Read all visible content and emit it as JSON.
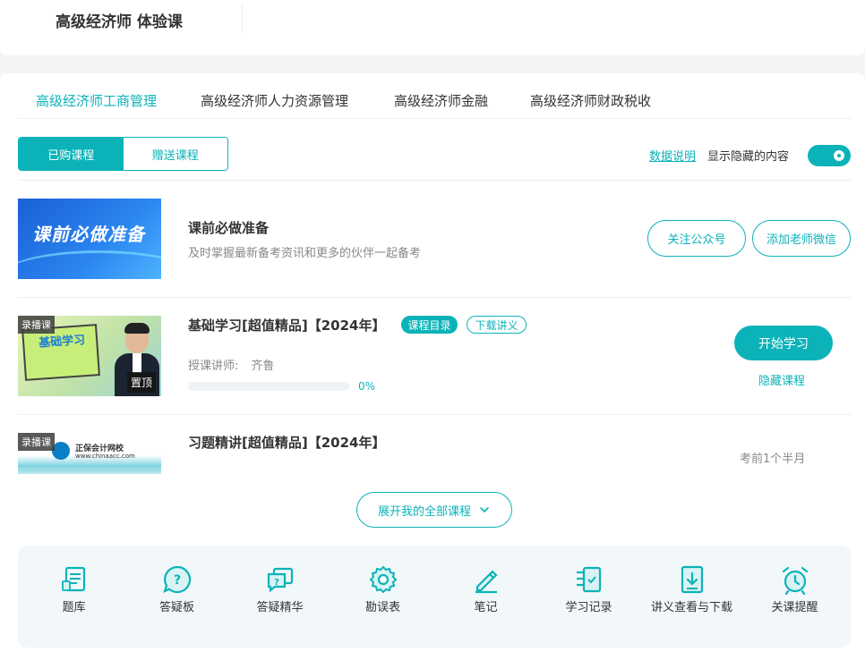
{
  "header": {
    "title": "高级经济师 体验课"
  },
  "tabs": [
    {
      "label": "高级经济师工商管理",
      "active": true
    },
    {
      "label": "高级经济师人力资源管理",
      "active": false
    },
    {
      "label": "高级经济师金融",
      "active": false
    },
    {
      "label": "高级经济师财政税收",
      "active": false
    }
  ],
  "segment": {
    "purchased": "已购课程",
    "gifted": "赠送课程"
  },
  "hidden_control": {
    "data_link": "数据说明",
    "label": "显示隐藏的内容",
    "toggle_on": true
  },
  "prep": {
    "banner_text": "课前必做准备",
    "title": "课前必做准备",
    "subtitle": "及时掌握最新备考资讯和更多的伙伴一起备考",
    "follow_button": "关注公众号",
    "wechat_button": "添加老师微信"
  },
  "courses": [
    {
      "badge": "录播课",
      "thumb_text": "基础学习",
      "pin": "置顶",
      "title": "基础学习[超值精品]【2024年】",
      "tag_catalog": "课程目录",
      "tag_download": "下载讲义",
      "teacher_label": "授课讲师:",
      "teacher_name": "齐鲁",
      "progress": 0,
      "progress_text": "0%",
      "start_button": "开始学习",
      "hide_button": "隐藏课程"
    },
    {
      "badge": "录播课",
      "logo_title": "正保会计网校",
      "logo_url": "www.chinaacc.com",
      "title": "习题精讲[超值精品]【2024年】",
      "time_ago": "考前1个半月"
    }
  ],
  "expand_button": "展开我的全部课程",
  "tools": [
    {
      "label": "题库",
      "icon": "question-bank-icon"
    },
    {
      "label": "答疑板",
      "icon": "qa-board-icon"
    },
    {
      "label": "答疑精华",
      "icon": "qa-essence-icon"
    },
    {
      "label": "勘误表",
      "icon": "errata-icon"
    },
    {
      "label": "笔记",
      "icon": "notes-icon"
    },
    {
      "label": "学习记录",
      "icon": "study-record-icon"
    },
    {
      "label": "讲义查看与下载",
      "icon": "handout-download-icon"
    },
    {
      "label": "关课提醒",
      "icon": "alarm-icon"
    }
  ],
  "colors": {
    "accent": "#0bb3b8",
    "text": "#333333",
    "muted": "#888888",
    "tools_bg": "#f2f8fa"
  }
}
